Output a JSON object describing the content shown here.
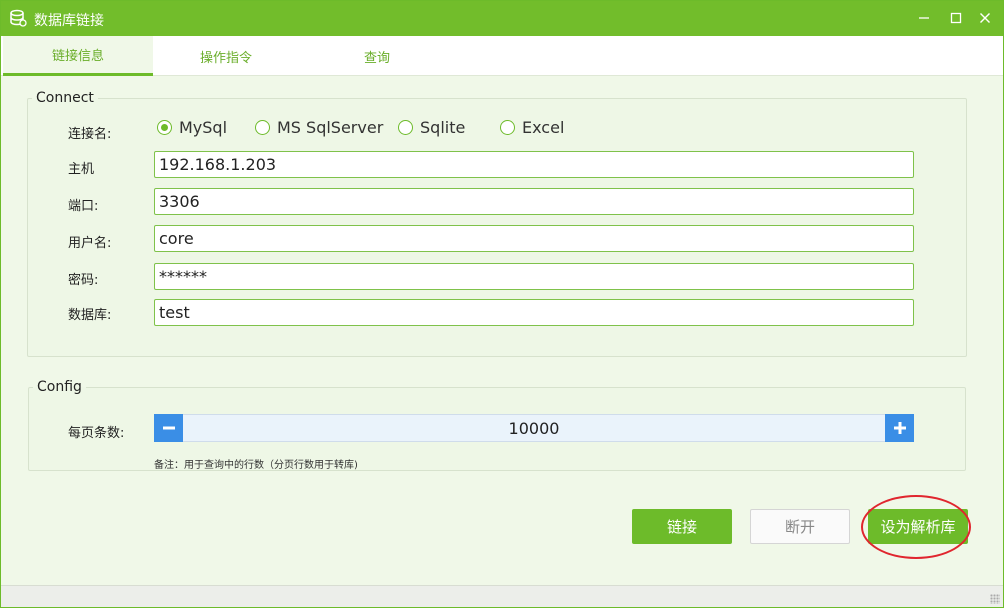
{
  "window": {
    "title": "数据库链接",
    "app_icon": "database-icon",
    "controls": {
      "minimize": "minimize-icon",
      "maximize": "maximize-icon",
      "close": "close-icon"
    }
  },
  "tabs": [
    {
      "label": "链接信息",
      "active": true
    },
    {
      "label": "操作指令",
      "active": false
    },
    {
      "label": "查询",
      "active": false
    }
  ],
  "connect": {
    "legend": "Connect",
    "db_type_label": "连接名:",
    "db_types": [
      {
        "label": "MySql",
        "selected": true
      },
      {
        "label": "MS SqlServer",
        "selected": false
      },
      {
        "label": "Sqlite",
        "selected": false
      },
      {
        "label": "Excel",
        "selected": false
      }
    ],
    "host_label": "主机",
    "host_value": "192.168.1.203",
    "port_label": "端口:",
    "port_value": "3306",
    "user_label": "用户名:",
    "user_value": "core",
    "password_label": "密码:",
    "password_value": "******",
    "database_label": "数据库:",
    "database_value": "test"
  },
  "config": {
    "legend": "Config",
    "page_size_label": "每页条数:",
    "page_size_value": "10000",
    "note": "备注：用于查询中的行数（分页行数用于转库)"
  },
  "actions": {
    "connect_label": "链接",
    "disconnect_label": "断开",
    "set_parse_db_label": "设为解析库"
  },
  "colors": {
    "accent": "#6dbb2a",
    "stepper_button": "#3a8ee6",
    "highlight": "#e0262e"
  }
}
